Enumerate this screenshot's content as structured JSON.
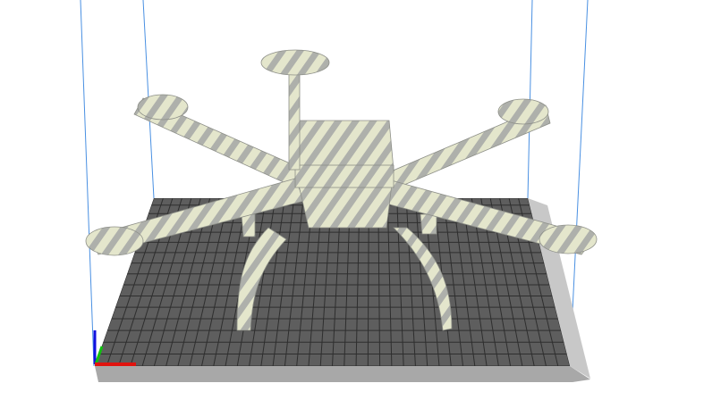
{
  "viewport": {
    "colors": {
      "background": "#ffffff",
      "build_volume_lines": "#4a90e2",
      "build_plate": "#5e5e5e",
      "grid": "#2e2e2e",
      "plate_edge": "#9a9a9a",
      "model_light": "#e4e6cc",
      "model_dark": "#a9aba6",
      "axis_x": "#e0140f",
      "axis_y": "#10c010",
      "axis_z": "#1010e0"
    },
    "icons": [
      "axis-gizmo-icon"
    ]
  }
}
